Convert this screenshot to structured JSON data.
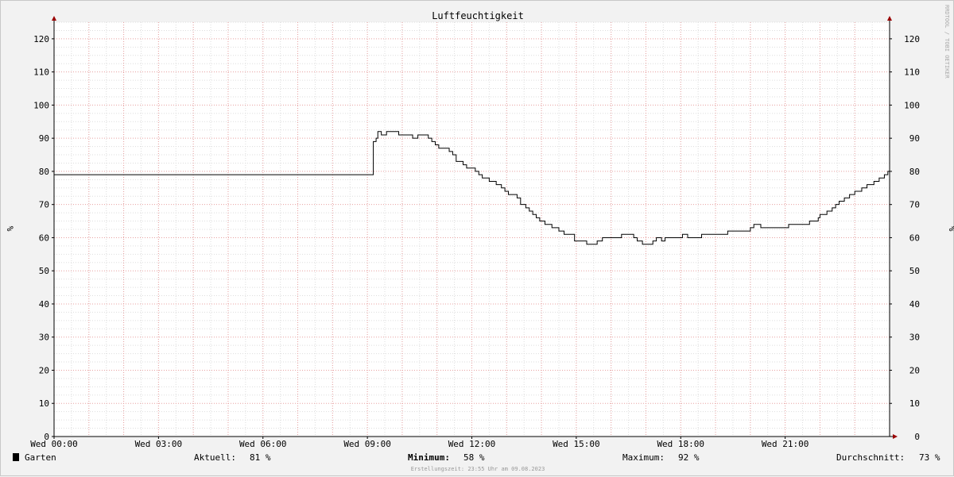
{
  "chart_data": {
    "type": "line",
    "title": "Luftfeuchtigkeit",
    "ylabel": "%",
    "ylim": [
      0,
      125
    ],
    "yticks": [
      0,
      10,
      20,
      30,
      40,
      50,
      60,
      70,
      80,
      90,
      100,
      110,
      120
    ],
    "xlim": [
      0,
      24
    ],
    "x_unit": "hours",
    "xticks": [
      {
        "hour": 0,
        "label": "Wed 00:00"
      },
      {
        "hour": 3,
        "label": "Wed 03:00"
      },
      {
        "hour": 6,
        "label": "Wed 06:00"
      },
      {
        "hour": 9,
        "label": "Wed 09:00"
      },
      {
        "hour": 12,
        "label": "Wed 12:00"
      },
      {
        "hour": 15,
        "label": "Wed 15:00"
      },
      {
        "hour": 18,
        "label": "Wed 18:00"
      },
      {
        "hour": 21,
        "label": "Wed 21:00"
      }
    ],
    "grid": true,
    "series": [
      {
        "name": "Garten",
        "color": "#000000",
        "points": [
          [
            0,
            79
          ],
          [
            9.15,
            79
          ],
          [
            9.17,
            89
          ],
          [
            9.25,
            90
          ],
          [
            9.3,
            92
          ],
          [
            9.4,
            91
          ],
          [
            9.55,
            92
          ],
          [
            9.9,
            91
          ],
          [
            10.2,
            91
          ],
          [
            10.3,
            90
          ],
          [
            10.45,
            91
          ],
          [
            10.6,
            91
          ],
          [
            10.75,
            90
          ],
          [
            10.85,
            89
          ],
          [
            10.95,
            88
          ],
          [
            11.05,
            87
          ],
          [
            11.35,
            86
          ],
          [
            11.45,
            85
          ],
          [
            11.55,
            83
          ],
          [
            11.75,
            82
          ],
          [
            11.85,
            81
          ],
          [
            12.1,
            80
          ],
          [
            12.2,
            79
          ],
          [
            12.3,
            78
          ],
          [
            12.5,
            77
          ],
          [
            12.7,
            76
          ],
          [
            12.85,
            75
          ],
          [
            12.95,
            74
          ],
          [
            13.05,
            73
          ],
          [
            13.3,
            72
          ],
          [
            13.4,
            70
          ],
          [
            13.55,
            69
          ],
          [
            13.65,
            68
          ],
          [
            13.75,
            67
          ],
          [
            13.85,
            66
          ],
          [
            13.95,
            65
          ],
          [
            14.1,
            64
          ],
          [
            14.3,
            63
          ],
          [
            14.5,
            62
          ],
          [
            14.65,
            61
          ],
          [
            14.85,
            61
          ],
          [
            14.95,
            59
          ],
          [
            15.3,
            58
          ],
          [
            15.5,
            58
          ],
          [
            15.6,
            59
          ],
          [
            15.75,
            60
          ],
          [
            16.2,
            60
          ],
          [
            16.3,
            61
          ],
          [
            16.55,
            61
          ],
          [
            16.65,
            60
          ],
          [
            16.75,
            59
          ],
          [
            16.9,
            58
          ],
          [
            17.2,
            59
          ],
          [
            17.3,
            60
          ],
          [
            17.45,
            59
          ],
          [
            17.55,
            60
          ],
          [
            18.0,
            60
          ],
          [
            18.05,
            61
          ],
          [
            18.2,
            60
          ],
          [
            18.6,
            61
          ],
          [
            19.3,
            61
          ],
          [
            19.35,
            62
          ],
          [
            19.9,
            62
          ],
          [
            20.0,
            63
          ],
          [
            20.1,
            64
          ],
          [
            20.3,
            63
          ],
          [
            21.1,
            64
          ],
          [
            21.65,
            64
          ],
          [
            21.7,
            65
          ],
          [
            21.95,
            66
          ],
          [
            22.0,
            67
          ],
          [
            22.2,
            68
          ],
          [
            22.35,
            69
          ],
          [
            22.45,
            70
          ],
          [
            22.55,
            71
          ],
          [
            22.7,
            72
          ],
          [
            22.85,
            73
          ],
          [
            23.0,
            74
          ],
          [
            23.2,
            75
          ],
          [
            23.35,
            76
          ],
          [
            23.55,
            77
          ],
          [
            23.7,
            78
          ],
          [
            23.85,
            79
          ],
          [
            23.95,
            80
          ],
          [
            24.1,
            81
          ],
          [
            24.2,
            81
          ]
        ]
      }
    ]
  },
  "legend": {
    "series_name": "Garten",
    "swatch_color": "#000000",
    "aktuell_label": "Aktuell:",
    "aktuell_value": "81 %",
    "minimum_label": "Minimum:",
    "minimum_value": "58 %",
    "maximum_label": "Maximum:",
    "maximum_value": "92 %",
    "durchschnitt_label": "Durchschnitt:",
    "durchschnitt_value": "73 %"
  },
  "footer": "Erstellungszeit: 23:55 Uhr am 09.08.2023",
  "watermark": "RRDTOOL / TOBI OETIKER",
  "colors": {
    "background": "#f2f2f2",
    "plot_background": "#ffffff",
    "major_grid": "#e8a0a0",
    "minor_grid": "#dddddd",
    "axis": "#000000",
    "arrow": "#990000"
  }
}
